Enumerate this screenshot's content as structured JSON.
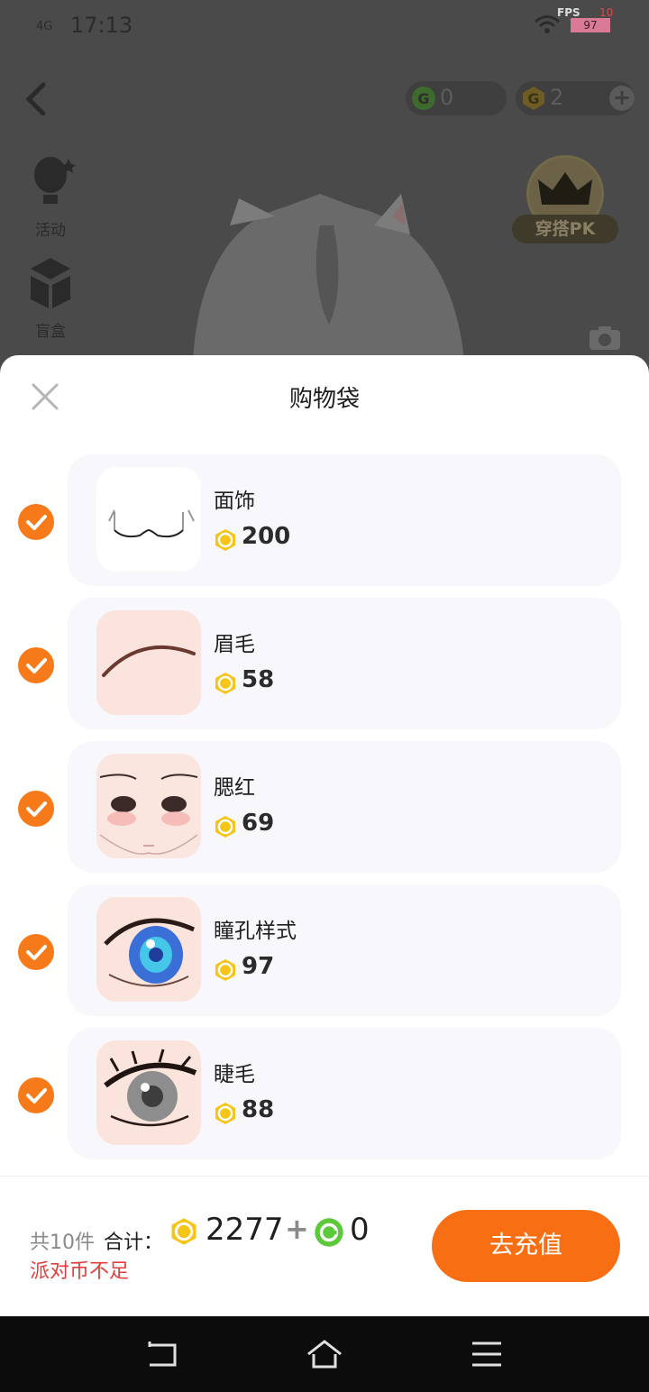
{
  "status_bar": {
    "time": "17:13",
    "network": "4G",
    "fps_label": "FPS",
    "fps_top": "10",
    "fps_value": "97"
  },
  "header": {
    "green_coins": "0",
    "gold_coins": "2",
    "back_icon": "chevron-left-icon",
    "plus_icon": "plus-icon"
  },
  "side_menu": {
    "activity_label": "活动",
    "blindbox_label": "盲盒",
    "pk_label": "穿搭PK"
  },
  "sheet": {
    "title": "购物袋",
    "items": [
      {
        "name": "面饰",
        "price": "200",
        "checked": true
      },
      {
        "name": "眉毛",
        "price": "58",
        "checked": true
      },
      {
        "name": "腮红",
        "price": "69",
        "checked": true
      },
      {
        "name": "瞳孔样式",
        "price": "97",
        "checked": true
      },
      {
        "name": "睫毛",
        "price": "88",
        "checked": true
      }
    ],
    "footer": {
      "count_text": "共10件",
      "sum_label": "合计：",
      "gold_total": "2277",
      "plus_sign": "+",
      "green_total": "0",
      "warning": "派对币不足",
      "recharge_label": "去充值"
    }
  },
  "colors": {
    "accent": "#f76f12",
    "check": "#f67a1a",
    "warning": "#e23e3e",
    "gold_coin": "#f5c518",
    "green_coin": "#5cc93a"
  }
}
